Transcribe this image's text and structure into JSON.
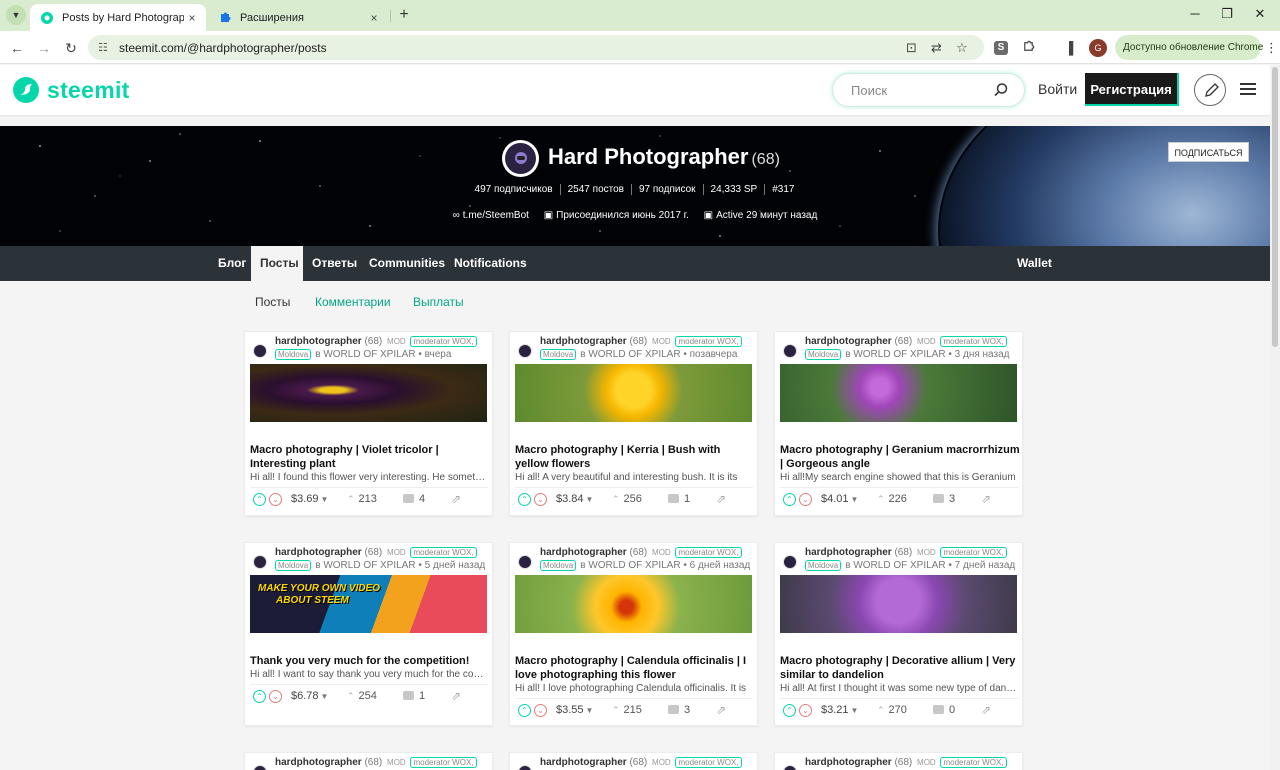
{
  "browser": {
    "tabs": [
      {
        "title": "Posts by Hard Photographer (68)",
        "close": "×"
      },
      {
        "title": "Расширения",
        "close": "×"
      }
    ],
    "new_tab": "+",
    "window_controls": {
      "minimize": "─",
      "maximize": "❐",
      "close": "✕"
    },
    "url": "steemit.com/@hardphotographer/posts",
    "update_label": "Доступно обновление Chrome",
    "profile_letter": "G",
    "ext_s": "S"
  },
  "header": {
    "logo_text": "steemit",
    "search_placeholder": "Поиск",
    "login": "Войти",
    "signup": "Регистрация"
  },
  "profile": {
    "name": "Hard Photographer",
    "rep": "(68)",
    "stats": [
      "497 подписчиков",
      "2547 постов",
      "97 подписок",
      "24,333 SP",
      "#317"
    ],
    "link": "t.me/SteemBot",
    "joined": "Присоединился июнь 2017 г.",
    "active": "Active 29 минут назад",
    "follow": "ПОДПИСАТЬСЯ"
  },
  "profile_nav": {
    "items": [
      "Блог",
      "Посты",
      "Ответы",
      "Communities",
      "Notifications"
    ],
    "wallet": "Wallet",
    "active": "Посты"
  },
  "subtabs": {
    "items": [
      "Посты",
      "Комментарии",
      "Выплаты"
    ],
    "active": "Посты"
  },
  "card_common": {
    "author": "hardphotographer",
    "rep": "(68)",
    "mod": "MOD",
    "role1": "moderator WOX,",
    "role2": "Moldova",
    "community_prefix": "в WORLD OF XPILAR"
  },
  "posts": [
    {
      "time": "• вчера",
      "title": "Macro photography | Violet tricolor | Interesting plant",
      "excerpt": "Hi all! I found this flower very interesting. He something",
      "payout": "$3.69",
      "votes": "213",
      "comments": "4"
    },
    {
      "time": "• позавчера",
      "title": "Macro photography | Kerria | Bush with yellow flowers",
      "excerpt": "Hi all! A very beautiful and interesting bush. It is its",
      "payout": "$3.84",
      "votes": "256",
      "comments": "1"
    },
    {
      "time": "• 3 дня назад",
      "title": "Macro photography | Geranium macrorrhizum | Gorgeous angle",
      "excerpt": "Hi all!My search engine showed that this is Geranium",
      "payout": "$4.01",
      "votes": "226",
      "comments": "3"
    },
    {
      "time": "• 5 дней назад",
      "title": "Thank you very much for the competition!",
      "excerpt": "Hi all! I want to say thank you very much for the competition",
      "payout": "$6.78",
      "votes": "254",
      "comments": "1",
      "image_text": [
        "MAKE YOUR OWN VIDEO",
        "ABOUT STEEM"
      ]
    },
    {
      "time": "• 6 дней назад",
      "title": "Macro photography | Calendula officinalis | I love photographing this flower",
      "excerpt": "Hi all! I love photographing Calendula officinalis. It is",
      "payout": "$3.55",
      "votes": "215",
      "comments": "3"
    },
    {
      "time": "• 7 дней назад",
      "title": "Macro photography | Decorative allium | Very similar to dandelion",
      "excerpt": "Hi all! At first I thought it was some new type of dandelion",
      "payout": "$3.21",
      "votes": "270",
      "comments": "0"
    }
  ],
  "colors": {
    "accent": "#06d6a9",
    "nav_bg": "#2c3338",
    "downvote": "#e67c7c"
  }
}
